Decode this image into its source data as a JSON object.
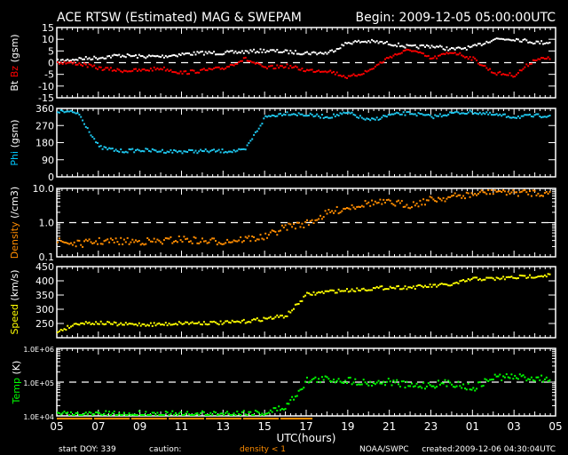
{
  "chart_data": {
    "type": "scatter",
    "title": "ACE RTSW (Estimated) MAG & SWEPAM",
    "begin": "Begin: 2009-12-05 05:00:00UTC",
    "xlabel": "UTC(hours)",
    "x_ticks": [
      "05",
      "07",
      "09",
      "11",
      "13",
      "15",
      "17",
      "19",
      "21",
      "23",
      "01",
      "03",
      "05"
    ],
    "x_hours": [
      0,
      1,
      2,
      3,
      4,
      5,
      6,
      7,
      8,
      9,
      10,
      11,
      12,
      13,
      14,
      15,
      16,
      17,
      18,
      19,
      20,
      21,
      22,
      23,
      24
    ],
    "panels": [
      {
        "id": "mag",
        "ylabel_parts": [
          {
            "text": "Bt",
            "color": "#ffffff"
          },
          {
            "text": " Bz",
            "color": "#ff0000"
          },
          {
            "text": " (gsm)",
            "color": "#ffffff"
          }
        ],
        "scale": "linear",
        "ylim": [
          -15,
          15
        ],
        "ticks": [
          "-15",
          "-10",
          "-5",
          "0",
          "5",
          "10",
          "15"
        ],
        "tick_values": [
          -15,
          -10,
          -5,
          0,
          5,
          10,
          15
        ],
        "dashed_at": 0,
        "series": [
          {
            "name": "Bt",
            "color": "#ffffff",
            "values": [
              1,
              2,
              2.5,
              3.5,
              3,
              3,
              4,
              4.5,
              4.5,
              5,
              5.5,
              5,
              4.5,
              4.5,
              9,
              9.5,
              8.5,
              7,
              7.5,
              6,
              7,
              10.5,
              10.5,
              9,
              9
            ]
          },
          {
            "name": "Bz",
            "color": "#ff0000",
            "values": [
              0.5,
              0,
              -2,
              -3,
              -3,
              -2,
              -4,
              -3,
              -2,
              2,
              -2,
              -1,
              -3,
              -3,
              -6,
              -3,
              3,
              6,
              2,
              5,
              2,
              -4,
              -5,
              2,
              2
            ]
          }
        ]
      },
      {
        "id": "phi",
        "ylabel_parts": [
          {
            "text": "Phi",
            "color": "#00c8ff"
          },
          {
            "text": " (gsm)",
            "color": "#ffffff"
          }
        ],
        "scale": "linear",
        "ylim": [
          0,
          360
        ],
        "ticks": [
          "0",
          "90",
          "180",
          "270",
          "360"
        ],
        "tick_values": [
          0,
          90,
          180,
          270,
          360
        ],
        "dashed_at": null,
        "series": [
          {
            "name": "Phi",
            "color": "#1ec8f0",
            "values": [
              350,
              340,
              160,
              140,
              145,
              140,
              138,
              140,
              140,
              142,
              320,
              340,
              330,
              320,
              340,
              300,
              330,
              340,
              320,
              340,
              345,
              330,
              320,
              325,
              330
            ]
          }
        ]
      },
      {
        "id": "density",
        "ylabel_parts": [
          {
            "text": "Density",
            "color": "#ff8c00"
          },
          {
            "text": " (/cm3)",
            "color": "#ffffff"
          }
        ],
        "scale": "log",
        "ylim": [
          0.1,
          10
        ],
        "ticks": [
          "0.1",
          "1.0",
          "10.0"
        ],
        "tick_values": [
          0.1,
          1,
          10
        ],
        "dashed_at": 1,
        "series": [
          {
            "name": "Density",
            "color": "#ff8c00",
            "values": [
              0.3,
              0.25,
              0.3,
              0.3,
              0.3,
              0.3,
              0.35,
              0.3,
              0.3,
              0.35,
              0.4,
              0.8,
              1.0,
              2,
              3,
              4,
              4,
              3.5,
              5,
              6,
              7,
              9,
              8,
              8,
              7
            ]
          }
        ]
      },
      {
        "id": "speed",
        "ylabel_parts": [
          {
            "text": "Speed",
            "color": "#ffff00"
          },
          {
            "text": " (km/s)",
            "color": "#ffffff"
          }
        ],
        "scale": "linear",
        "ylim": [
          200,
          450
        ],
        "ticks": [
          "250",
          "300",
          "350",
          "400",
          "450"
        ],
        "tick_values": [
          250,
          300,
          350,
          400,
          450
        ],
        "dashed_at": null,
        "series": [
          {
            "name": "Speed",
            "color": "#ffff00",
            "values": [
              225,
              255,
              255,
              250,
              250,
              250,
              255,
              255,
              255,
              260,
              270,
              280,
              355,
              365,
              370,
              375,
              380,
              380,
              385,
              390,
              410,
              410,
              415,
              420,
              425
            ]
          }
        ]
      },
      {
        "id": "temp",
        "ylabel_parts": [
          {
            "text": "Temp",
            "color": "#00ff00"
          },
          {
            "text": " (K)",
            "color": "#ffffff"
          }
        ],
        "scale": "log",
        "ylim": [
          10000,
          1000000
        ],
        "ticks": [
          "1.0E+04",
          "1.0E+05",
          "1.0E+06"
        ],
        "tick_values": [
          10000,
          100000,
          1000000
        ],
        "dashed_at": 100000,
        "series": [
          {
            "name": "Temp",
            "color": "#00ff00",
            "values": [
              12000,
              11000,
              12000,
              11000,
              12000,
              12000,
              11000,
              12000,
              12000,
              13000,
              13000,
              20000,
              120000,
              130000,
              120000,
              100000,
              110000,
              80000,
              90000,
              100000,
              70000,
              150000,
              150000,
              140000,
              130000
            ]
          }
        ]
      }
    ],
    "caution_bar": {
      "color": "#ff8c00",
      "from_hour": 0,
      "to_hour": 12.3
    }
  },
  "footer": {
    "start_doy": "start DOY: 339",
    "caution": "caution:",
    "density_note": "density < 1",
    "agency": "NOAA/SWPC",
    "created": "created:2009-12-06 04:30:04UTC"
  }
}
